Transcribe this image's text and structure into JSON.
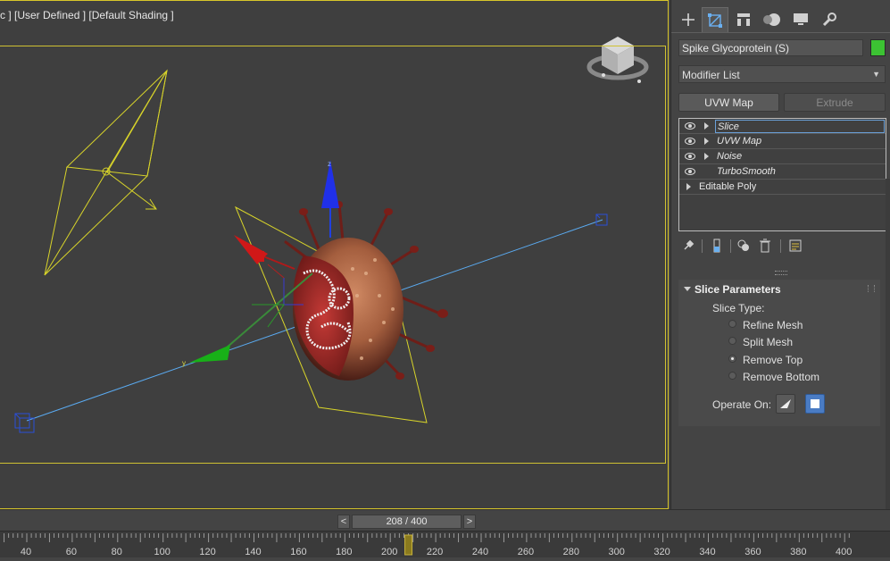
{
  "viewport": {
    "label": "c ] [User Defined ] [Default Shading ]",
    "gizmo_z_label": "z",
    "gizmo_y_label": "y",
    "gizmo_x_label": "x"
  },
  "panel": {
    "tabs": [
      {
        "name": "create-tab",
        "icon": "plus-icon"
      },
      {
        "name": "modify-tab",
        "icon": "modify-icon",
        "active": true
      },
      {
        "name": "hierarchy-tab",
        "icon": "hierarchy-icon"
      },
      {
        "name": "motion-tab",
        "icon": "motion-icon"
      },
      {
        "name": "display-tab",
        "icon": "display-icon"
      },
      {
        "name": "utilities-tab",
        "icon": "wrench-icon"
      }
    ],
    "object_name": "Spike Glycoprotein (S)",
    "object_color": "#3cc233",
    "modifier_list": "Modifier List",
    "buttons": {
      "uvw_map": "UVW Map",
      "extrude": "Extrude"
    },
    "stack": [
      {
        "label": "Slice",
        "selected": true
      },
      {
        "label": "UVW Map"
      },
      {
        "label": "Noise"
      },
      {
        "label": "TurboSmooth"
      },
      {
        "label": "Editable Poly"
      }
    ],
    "rollout": {
      "title": "Slice Parameters",
      "slice_type_label": "Slice Type:",
      "options": [
        "Refine Mesh",
        "Split Mesh",
        "Remove Top",
        "Remove Bottom"
      ],
      "selected_option": "Remove Top",
      "operate_on_label": "Operate On:"
    }
  },
  "timeslider": {
    "prev": "<",
    "next": ">",
    "frame_display": "208 / 400",
    "current_frame": 208,
    "total_frames": 400
  },
  "trackbar": {
    "ticks": [
      "40",
      "60",
      "80",
      "100",
      "120",
      "140",
      "160",
      "180",
      "200",
      "220",
      "240",
      "260",
      "280",
      "300",
      "320",
      "340",
      "360",
      "380",
      "400"
    ]
  },
  "colors": {
    "viewport_border": "#d8c62a",
    "accent_blue": "#4a7cc4",
    "camera_yellow": "#d8d42a",
    "virus_red": "#8e2a22"
  }
}
